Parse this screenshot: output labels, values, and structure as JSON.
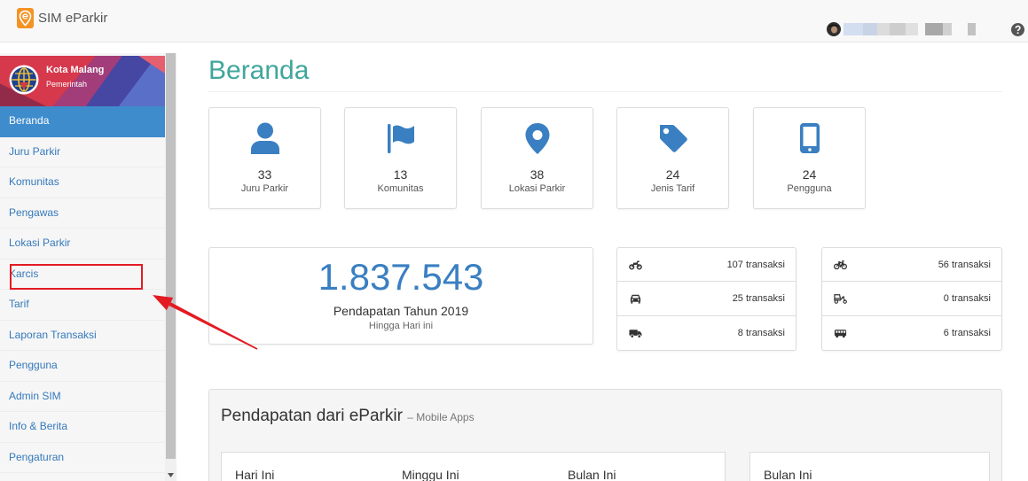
{
  "app": {
    "title": "SIM eParkir",
    "logo_icon": "map-pin-logo-icon"
  },
  "header": {
    "user_icon": "avatar-icon",
    "help_icon": "question-circle-icon"
  },
  "sidebar": {
    "org_name": "Kota Malang",
    "org_type": "Pemerintah",
    "items": [
      {
        "label": "Beranda",
        "active": true
      },
      {
        "label": "Juru Parkir"
      },
      {
        "label": "Komunitas"
      },
      {
        "label": "Pengawas"
      },
      {
        "label": "Lokasi Parkir"
      },
      {
        "label": "Karcis",
        "highlighted": true
      },
      {
        "label": "Tarif"
      },
      {
        "label": "Laporan Transaksi"
      },
      {
        "label": "Pengguna"
      },
      {
        "label": "Admin SIM"
      },
      {
        "label": "Info & Berita"
      },
      {
        "label": "Pengaturan"
      }
    ]
  },
  "page": {
    "title": "Beranda"
  },
  "stats": [
    {
      "value": "33",
      "label": "Juru Parkir",
      "icon": "user-icon"
    },
    {
      "value": "13",
      "label": "Komunitas",
      "icon": "flag-icon"
    },
    {
      "value": "38",
      "label": "Lokasi Parkir",
      "icon": "map-marker-icon"
    },
    {
      "value": "24",
      "label": "Jenis Tarif",
      "icon": "tag-icon"
    },
    {
      "value": "24",
      "label": "Pengguna",
      "icon": "mobile-icon"
    }
  ],
  "revenue": {
    "amount": "1.837.543",
    "title": "Pendapatan Tahun 2019",
    "subtitle": "Hingga Hari ini"
  },
  "transactions": {
    "left": [
      {
        "icon": "motorcycle-icon",
        "text": "107 transaksi"
      },
      {
        "icon": "car-icon",
        "text": "25 transaksi"
      },
      {
        "icon": "truck-icon",
        "text": "8 transaksi"
      }
    ],
    "right": [
      {
        "icon": "bicycle-icon",
        "text": "56 transaksi"
      },
      {
        "icon": "rickshaw-icon",
        "text": "0 transaksi"
      },
      {
        "icon": "bus-icon",
        "text": "6 transaksi"
      }
    ]
  },
  "mobile_panel": {
    "title": "Pendapatan dari eParkir",
    "subtitle": "– Mobile Apps",
    "columns": [
      "Hari Ini",
      "Minggu Ini",
      "Bulan Ini"
    ],
    "side_column": "Bulan Ini"
  },
  "colors": {
    "primary": "#3a7fc1",
    "heading": "#40a69c",
    "active_menu": "#3f8ccc",
    "logo": "#f39325",
    "annotation": "#e31b23"
  }
}
